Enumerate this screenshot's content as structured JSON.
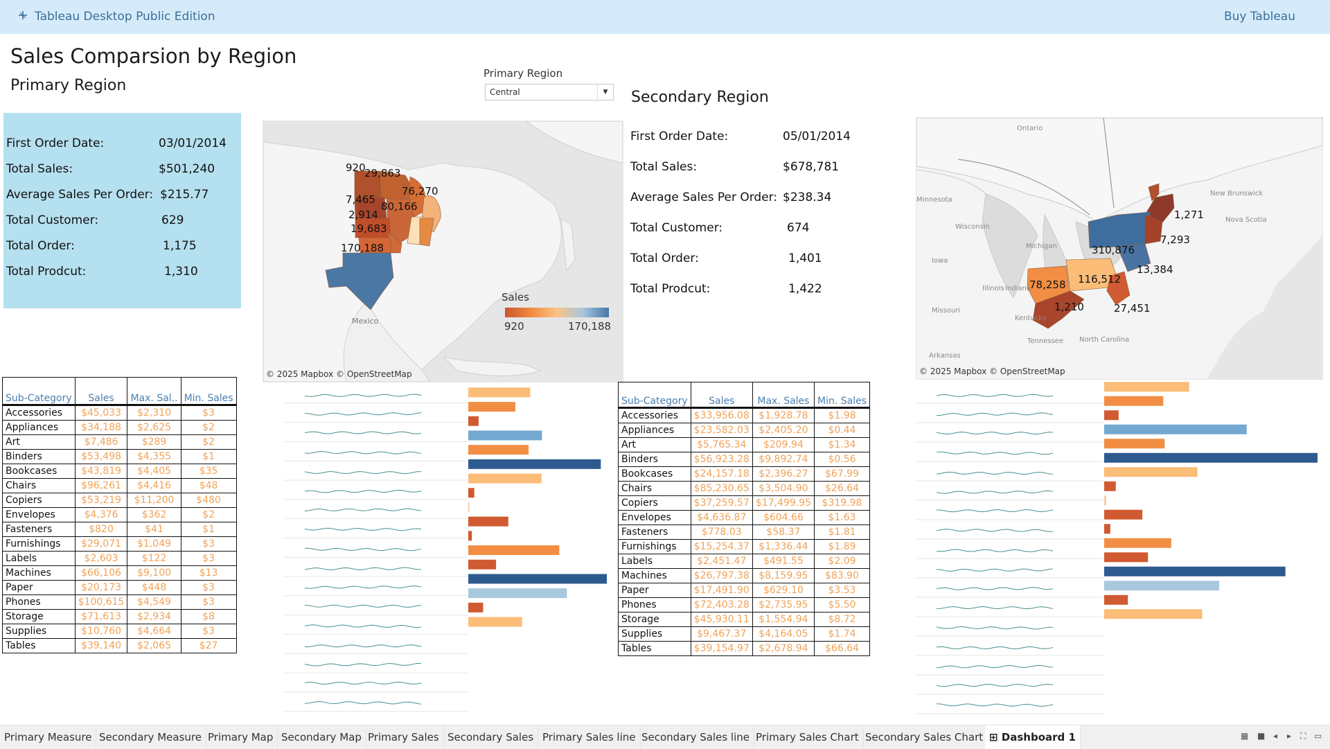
{
  "app": {
    "title": "Tableau Desktop Public Edition",
    "buy_label": "Buy Tableau"
  },
  "dashboard": {
    "title": "Sales Comparsion by Region",
    "primary_heading": "Primary Region",
    "secondary_heading": "Secondary Region"
  },
  "filter": {
    "label": "Primary Region",
    "value": "Central"
  },
  "primary_metrics": [
    {
      "label": "First Order Date:",
      "value": "03/01/2014"
    },
    {
      "label": "Total Sales:",
      "value": "$501,240"
    },
    {
      "label": "Average Sales Per Order:",
      "value": "$215.77"
    },
    {
      "label": "Total Customer:",
      "value": "629"
    },
    {
      "label": "Total Order:",
      "value": "1,175"
    },
    {
      "label": "Total Prodcut:",
      "value": "1,310"
    }
  ],
  "secondary_metrics": [
    {
      "label": "First Order Date:",
      "value": "05/01/2014"
    },
    {
      "label": "Total Sales:",
      "value": "$678,781"
    },
    {
      "label": "Average Sales Per Order:",
      "value": "$238.34"
    },
    {
      "label": "Total Customer:",
      "value": "674"
    },
    {
      "label": "Total Order:",
      "value": "1,401"
    },
    {
      "label": "Total Prodcut:",
      "value": "1,422"
    }
  ],
  "primary_map": {
    "credit": "© 2025 Mapbox © OpenStreetMap",
    "place_labels": [
      "Mexico"
    ],
    "labels": [
      "920",
      "29,863",
      "76,270",
      "7,465",
      "80,166",
      "2,914",
      "19,683",
      "170,188"
    ]
  },
  "legend": {
    "title": "Sales",
    "min": "920",
    "max": "170,188"
  },
  "secondary_map": {
    "credit": "© 2025 Mapbox © OpenStreetMap",
    "place_labels": [
      "Ontario",
      "Minnesota",
      "Wisconsin",
      "Michigan",
      "Iowa",
      "Illinois",
      "Indiana",
      "Missouri",
      "Kentucky",
      "Tennessee",
      "North Carolina",
      "Arkansas",
      "New Brunswick",
      "Nova Scotia"
    ],
    "labels": [
      "1,271",
      "7,293",
      "310,876",
      "13,384",
      "78,258",
      "116,512",
      "1,210",
      "27,451"
    ]
  },
  "primary_table": {
    "headers": [
      "Sub-Category",
      "Sales",
      "Max. Sal..",
      "Min. Sales"
    ],
    "rows": [
      [
        "Accessories",
        "$45,033",
        "$2,310",
        "$3"
      ],
      [
        "Appliances",
        "$34,188",
        "$2,625",
        "$2"
      ],
      [
        "Art",
        "$7,486",
        "$289",
        "$2"
      ],
      [
        "Binders",
        "$53,498",
        "$4,355",
        "$1"
      ],
      [
        "Bookcases",
        "$43,819",
        "$4,405",
        "$35"
      ],
      [
        "Chairs",
        "$96,261",
        "$4,416",
        "$48"
      ],
      [
        "Copiers",
        "$53,219",
        "$11,200",
        "$480"
      ],
      [
        "Envelopes",
        "$4,376",
        "$362",
        "$2"
      ],
      [
        "Fasteners",
        "$820",
        "$41",
        "$1"
      ],
      [
        "Furnishings",
        "$29,071",
        "$1,049",
        "$3"
      ],
      [
        "Labels",
        "$2,603",
        "$122",
        "$3"
      ],
      [
        "Machines",
        "$66,106",
        "$9,100",
        "$13"
      ],
      [
        "Paper",
        "$20,173",
        "$448",
        "$3"
      ],
      [
        "Phones",
        "$100,615",
        "$4,549",
        "$3"
      ],
      [
        "Storage",
        "$71,613",
        "$2,934",
        "$8"
      ],
      [
        "Supplies",
        "$10,760",
        "$4,664",
        "$3"
      ],
      [
        "Tables",
        "$39,140",
        "$2,065",
        "$27"
      ]
    ]
  },
  "secondary_table": {
    "headers": [
      "Sub-Category",
      "Sales",
      "Max. Sales",
      "Min. Sales"
    ],
    "rows": [
      [
        "Accessories",
        "$33,956.08",
        "$1,928.78",
        "$1.98"
      ],
      [
        "Appliances",
        "$23,582.03",
        "$2,405.20",
        "$0.44"
      ],
      [
        "Art",
        "$5,765.34",
        "$209.94",
        "$1.34"
      ],
      [
        "Binders",
        "$56,923.28",
        "$9,892.74",
        "$0.56"
      ],
      [
        "Bookcases",
        "$24,157.18",
        "$2,396.27",
        "$67.99"
      ],
      [
        "Chairs",
        "$85,230.65",
        "$3,504.90",
        "$26.64"
      ],
      [
        "Copiers",
        "$37,259.57",
        "$17,499.95",
        "$319.98"
      ],
      [
        "Envelopes",
        "$4,636.87",
        "$604.66",
        "$1.63"
      ],
      [
        "Fasteners",
        "$778.03",
        "$58.37",
        "$1.81"
      ],
      [
        "Furnishings",
        "$15,254.37",
        "$1,336.44",
        "$1.89"
      ],
      [
        "Labels",
        "$2,451.47",
        "$491.55",
        "$2.09"
      ],
      [
        "Machines",
        "$26,797.38",
        "$8,159.95",
        "$83.90"
      ],
      [
        "Paper",
        "$17,491.90",
        "$629.10",
        "$3.53"
      ],
      [
        "Phones",
        "$72,403.28",
        "$2,735.95",
        "$5.50"
      ],
      [
        "Storage",
        "$45,930.11",
        "$1,554.94",
        "$8.72"
      ],
      [
        "Supplies",
        "$9,467.37",
        "$4,164.05",
        "$1.74"
      ],
      [
        "Tables",
        "$39,154.97",
        "$2,678.94",
        "$66.64"
      ]
    ]
  },
  "chart_data": [
    {
      "type": "bar",
      "title": "",
      "categories": [
        "Accessories",
        "Appliances",
        "Art",
        "Binders",
        "Bookcases",
        "Chairs",
        "Copiers",
        "Envelopes",
        "Fasteners",
        "Furnishings",
        "Labels",
        "Machines",
        "Paper",
        "Phones",
        "Storage",
        "Supplies",
        "Tables"
      ],
      "values": [
        45033,
        34188,
        7486,
        53498,
        43819,
        96261,
        53219,
        4376,
        820,
        29071,
        2603,
        66106,
        20173,
        100615,
        71613,
        10760,
        39140
      ]
    },
    {
      "type": "bar",
      "title": "",
      "categories": [
        "Accessories",
        "Appliances",
        "Art",
        "Binders",
        "Bookcases",
        "Chairs",
        "Copiers",
        "Envelopes",
        "Fasteners",
        "Furnishings",
        "Labels",
        "Machines",
        "Paper",
        "Phones",
        "Storage",
        "Supplies",
        "Tables"
      ],
      "values": [
        33956.08,
        23582.03,
        5765.34,
        56923.28,
        24157.18,
        85230.65,
        37259.57,
        4636.87,
        778.03,
        15254.37,
        2451.47,
        26797.38,
        17491.9,
        72403.28,
        45930.11,
        9467.37,
        39154.97
      ]
    }
  ],
  "colors": {
    "topbar": "#d6ebfa",
    "panel": "#b5e0ef",
    "brand_text": "#3a6f98",
    "sparkline": "#4a8f8f",
    "value_text": "#f1a257"
  },
  "tabs": [
    "Primary Measure",
    "Secondary Measure",
    "Primary Map",
    "Secondary Map",
    "Primary Sales",
    "Secondary Sales",
    "Primary Sales line",
    "Secondary Sales line",
    "Primary Sales Chart",
    "Secondary Sales Chart",
    "Dashboard 1"
  ],
  "active_tab": "Dashboard 1",
  "status_icons": [
    "grid-view-icon",
    "sheet-view-icon",
    "prev-icon",
    "next-icon",
    "fullscreen-icon",
    "present-icon"
  ]
}
